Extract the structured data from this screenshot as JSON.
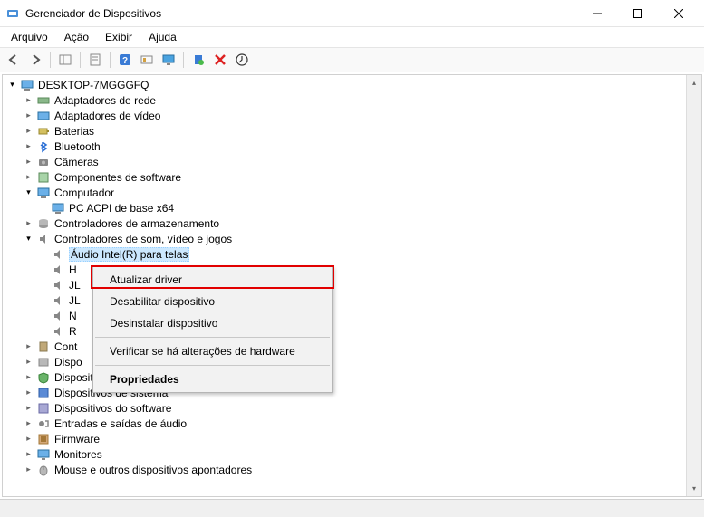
{
  "window": {
    "title": "Gerenciador de Dispositivos"
  },
  "menu": {
    "file": "Arquivo",
    "action": "Ação",
    "view": "Exibir",
    "help": "Ajuda"
  },
  "tree": {
    "root": "DESKTOP-7MGGGFQ",
    "items": [
      "Adaptadores de rede",
      "Adaptadores de vídeo",
      "Baterias",
      "Bluetooth",
      "Câmeras",
      "Componentes de software",
      "Computador",
      "Controladores de armazenamento",
      "Controladores de som, vídeo e jogos",
      "Dispositivos de segurança",
      "Dispositivos de sistema",
      "Dispositivos do software",
      "Entradas e saídas de áudio",
      "Firmware",
      "Monitores",
      "Mouse e outros dispositivos apontadores"
    ],
    "computer_child": "PC ACPI de base x64",
    "sound_children": {
      "sel": "Áudio Intel(R) para telas",
      "h": "H",
      "jl": "JL",
      "jl2": "JL",
      "n": "N",
      "r": "R"
    },
    "cont_partial": "Cont",
    "disp_partial": "Dispo"
  },
  "context": {
    "update": "Atualizar driver",
    "disable": "Desabilitar dispositivo",
    "uninstall": "Desinstalar dispositivo",
    "scan": "Verificar se há alterações de hardware",
    "properties": "Propriedades"
  }
}
